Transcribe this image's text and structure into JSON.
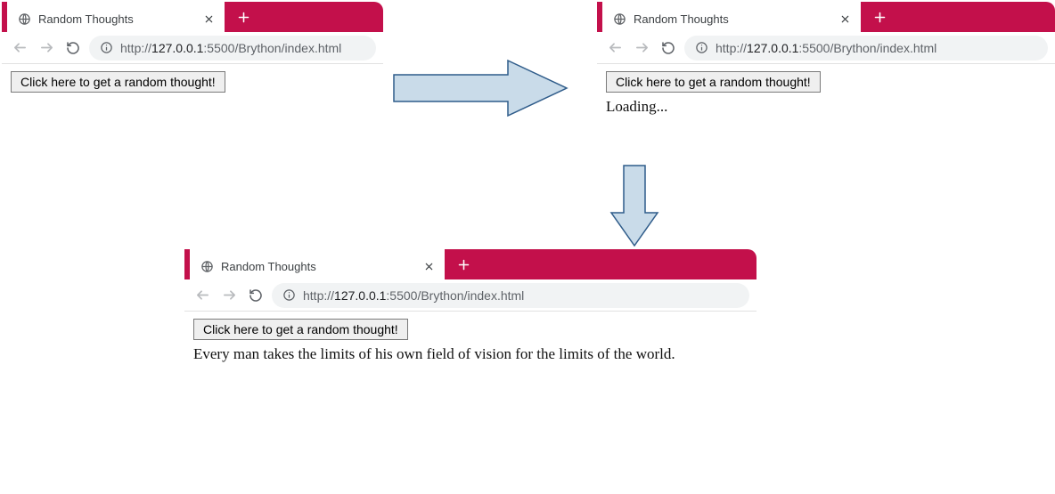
{
  "accent_color": "#c3104b",
  "arrow_fill": "#c9dbe9",
  "arrow_stroke": "#2f5c8a",
  "window1": {
    "tab_title": "Random Thoughts",
    "url_prefix": "http://",
    "url_host": "127.0.0.1",
    "url_path": ":5500/Brython/index.html",
    "button_label": "Click here to get a random thought!",
    "output_text": ""
  },
  "window2": {
    "tab_title": "Random Thoughts",
    "url_prefix": "http://",
    "url_host": "127.0.0.1",
    "url_path": ":5500/Brython/index.html",
    "button_label": "Click here to get a random thought!",
    "output_text": "Loading..."
  },
  "window3": {
    "tab_title": "Random Thoughts",
    "url_prefix": "http://",
    "url_host": "127.0.0.1",
    "url_path": ":5500/Brython/index.html",
    "button_label": "Click here to get a random thought!",
    "output_text": "Every man takes the limits of his own field of vision for the limits of the world."
  }
}
